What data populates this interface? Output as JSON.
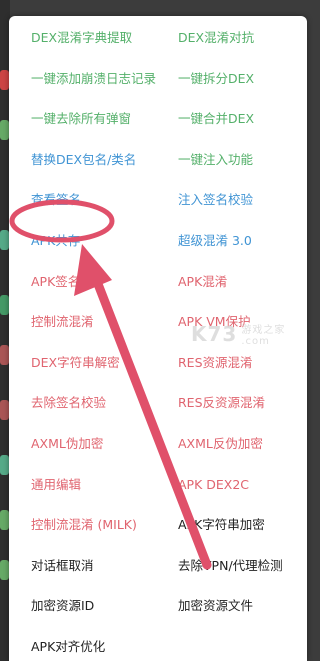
{
  "menu": {
    "left": [
      {
        "label": "DEX混淆字典提取",
        "color": "green"
      },
      {
        "label": "一键添加崩溃日志记录",
        "color": "green"
      },
      {
        "label": "一键去除所有弹窗",
        "color": "green"
      },
      {
        "label": "替换DEX包名/类名",
        "color": "blue"
      },
      {
        "label": "查看签名",
        "color": "blue"
      },
      {
        "label": "APK共存",
        "color": "blue"
      },
      {
        "label": "APK签名",
        "color": "red"
      },
      {
        "label": "控制流混淆",
        "color": "red"
      },
      {
        "label": "DEX字符串解密",
        "color": "red"
      },
      {
        "label": "去除签名校验",
        "color": "red"
      },
      {
        "label": "AXML伪加密",
        "color": "red"
      },
      {
        "label": "通用编辑",
        "color": "red"
      },
      {
        "label": "控制流混淆 (MILK)",
        "color": "red"
      },
      {
        "label": "对话框取消",
        "color": "black"
      },
      {
        "label": "加密资源ID",
        "color": "black"
      },
      {
        "label": "APK对齐优化",
        "color": "black"
      }
    ],
    "right": [
      {
        "label": "DEX混淆对抗",
        "color": "green"
      },
      {
        "label": "一键拆分DEX",
        "color": "green"
      },
      {
        "label": "一键合并DEX",
        "color": "green"
      },
      {
        "label": "一键注入功能",
        "color": "green"
      },
      {
        "label": "注入签名校验",
        "color": "blue"
      },
      {
        "label": "超级混淆 3.0",
        "color": "blue"
      },
      {
        "label": "APK混淆",
        "color": "red"
      },
      {
        "label": "APK VM保护",
        "color": "red"
      },
      {
        "label": "RES资源混淆",
        "color": "red"
      },
      {
        "label": "RES反资源混淆",
        "color": "red"
      },
      {
        "label": "AXML反伪加密",
        "color": "red"
      },
      {
        "label": "APK DEX2C",
        "color": "red"
      },
      {
        "label": "APK字符串加密",
        "color": "black"
      },
      {
        "label": "去除VPN/代理检测",
        "color": "black"
      },
      {
        "label": "加密资源文件",
        "color": "black"
      }
    ]
  },
  "watermark": {
    "text": "K73",
    "sub_line1": "游戏之家",
    "sub_line2": ".com"
  },
  "colors": {
    "green": "#54b06a",
    "blue": "#4094d4",
    "red": "#e0646f",
    "black": "#222222",
    "annotation": "#e0506a"
  }
}
